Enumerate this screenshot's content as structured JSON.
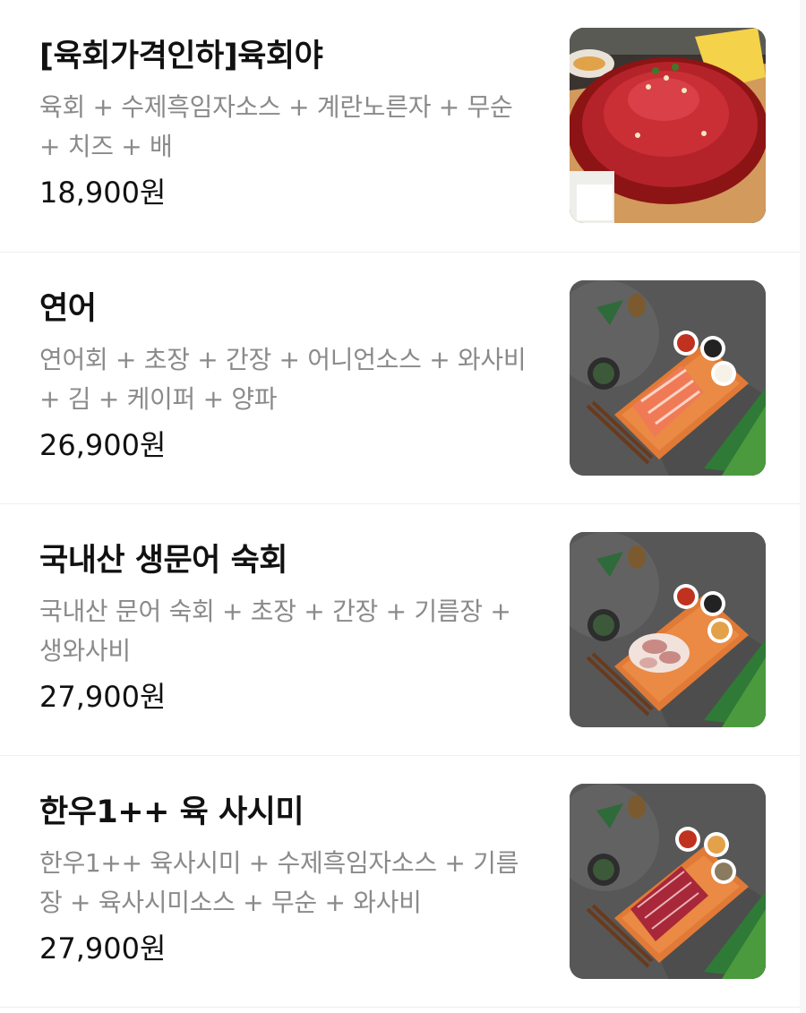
{
  "menu": {
    "items": [
      {
        "name": "[육회가격인하]육회야",
        "desc_line1": "육회 + 수제흑임자소스 + 계란노른자 + 무순",
        "desc_line2": "+ 치즈 + 배",
        "price": "18,900원",
        "photo_icon": "yukhoe-photo"
      },
      {
        "name": "연어",
        "desc_line1": "연어회 + 초장 + 간장 + 어니언소스 + 와사비",
        "desc_line2": "+ 김 + 케이퍼 + 양파",
        "price": "26,900원",
        "photo_icon": "salmon-platter-photo"
      },
      {
        "name": "국내산 생문어 숙회",
        "desc_line1": "국내산 문어 숙회 + 초장 + 간장 + 기름장 +",
        "desc_line2": "생와사비",
        "price": "27,900원",
        "photo_icon": "octopus-platter-photo"
      },
      {
        "name": "한우1++ 육 사시미",
        "desc_line1": "한우1++ 육사시미 + 수제흑임자소스 + 기름",
        "desc_line2": "장 + 육사시미소스 + 무순 + 와사비",
        "price": "27,900원",
        "photo_icon": "beef-sashimi-platter-photo"
      }
    ]
  }
}
